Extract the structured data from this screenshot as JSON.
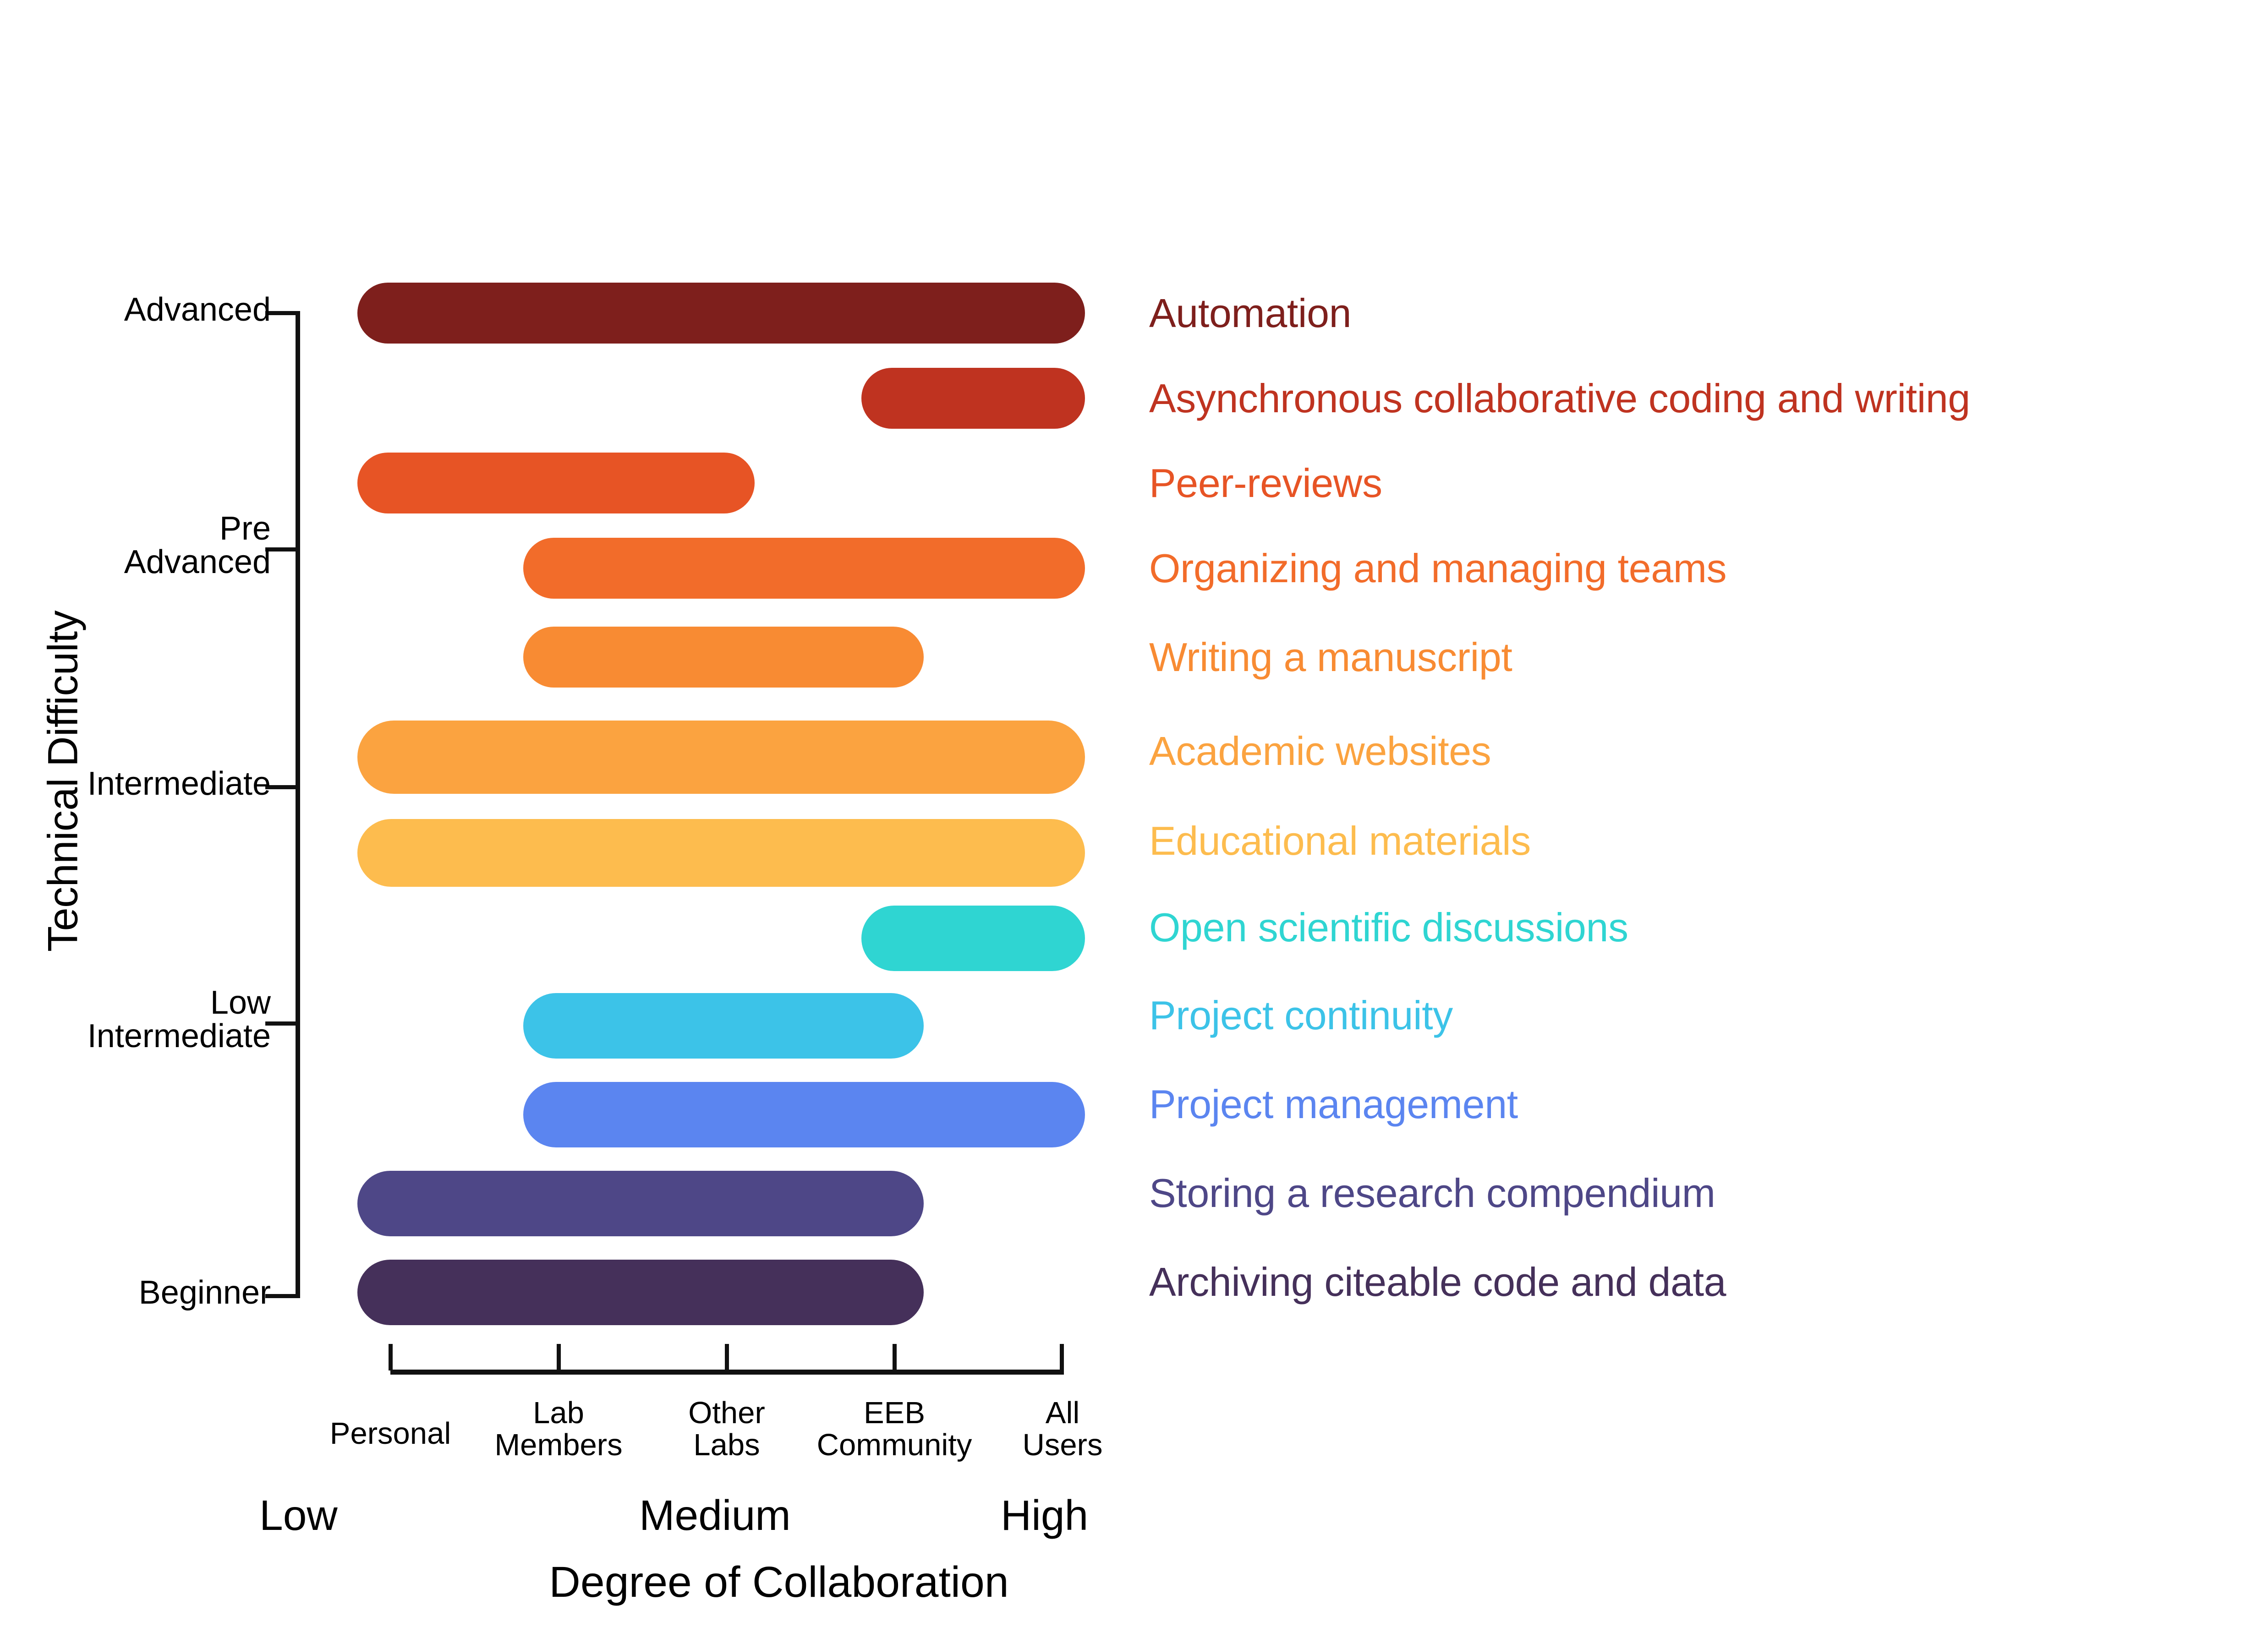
{
  "chart_data": {
    "type": "bar",
    "title": "",
    "xlabel": "Degree of Collaboration",
    "ylabel": "Technical Difficulty",
    "grid": false,
    "legend_position": "right-inline",
    "x_tick_labels": [
      "Personal",
      "Lab\nMembers",
      "Other\nLabs",
      "EEB\nCommunity",
      "All\nUsers"
    ],
    "x_tick_values": [
      1,
      2,
      3,
      4,
      5
    ],
    "x_level_labels": [
      "Low",
      "Medium",
      "High"
    ],
    "xlim": [
      0.75,
      5.25
    ],
    "y_tick_labels": [
      "Advanced",
      "Pre\nAdvanced",
      "Intermediate",
      "Low\nIntermediate",
      "Beginner"
    ],
    "y_difficulty_levels": [
      "Advanced",
      "Pre Advanced",
      "Intermediate",
      "Low Intermediate",
      "Beginner"
    ],
    "bars": [
      {
        "label": "Automation",
        "start": 1,
        "end": 5,
        "color": "#7E1F1C",
        "difficulty": "Advanced"
      },
      {
        "label": "Asynchronous collaborative coding and writing",
        "start": 4,
        "end": 5,
        "color": "#BF3320",
        "difficulty": "Advanced"
      },
      {
        "label": "Peer-reviews",
        "start": 1,
        "end": 3.2,
        "color": "#E75425",
        "difficulty": "Pre Advanced"
      },
      {
        "label": "Organizing and managing teams",
        "start": 2,
        "end": 5,
        "color": "#F26C2A",
        "difficulty": "Pre Advanced"
      },
      {
        "label": "Writing a manuscript",
        "start": 2,
        "end": 3.7,
        "color": "#F88B33",
        "difficulty": "Pre Advanced"
      },
      {
        "label": "Academic websites",
        "start": 1,
        "end": 5,
        "color": "#FBA340",
        "difficulty": "Intermediate"
      },
      {
        "label": "Educational materials",
        "start": 1,
        "end": 5,
        "color": "#FDBC4E",
        "difficulty": "Intermediate"
      },
      {
        "label": "Open scientific discussions",
        "start": 4,
        "end": 5,
        "color": "#2FD5D2",
        "difficulty": "Low Intermediate"
      },
      {
        "label": "Project continuity",
        "start": 2,
        "end": 3.7,
        "color": "#3CC3E8",
        "difficulty": "Low Intermediate"
      },
      {
        "label": "Project management",
        "start": 2,
        "end": 5,
        "color": "#5B85F0",
        "difficulty": "Low Intermediate"
      },
      {
        "label": "Storing a research compendium",
        "start": 1,
        "end": 3.7,
        "color": "#4E4787",
        "difficulty": "Beginner"
      },
      {
        "label": "Archiving citeable code and data",
        "start": 1,
        "end": 3.7,
        "color": "#45305A",
        "difficulty": "Beginner"
      }
    ]
  },
  "axes": {
    "y_title": "Technical Difficulty",
    "x_title": "Degree of Collaboration",
    "y_ticks": [
      {
        "label": "Advanced"
      },
      {
        "label": "Pre\nAdvanced"
      },
      {
        "label": "Intermediate"
      },
      {
        "label": "Low\nIntermediate"
      },
      {
        "label": "Beginner"
      }
    ],
    "x_ticks": [
      {
        "label": "Personal"
      },
      {
        "label": "Lab\nMembers"
      },
      {
        "label": "Other\nLabs"
      },
      {
        "label": "EEB\nCommunity"
      },
      {
        "label": "All\nUsers"
      }
    ],
    "x_levels": [
      {
        "label": "Low"
      },
      {
        "label": "Medium"
      },
      {
        "label": "High"
      }
    ]
  }
}
